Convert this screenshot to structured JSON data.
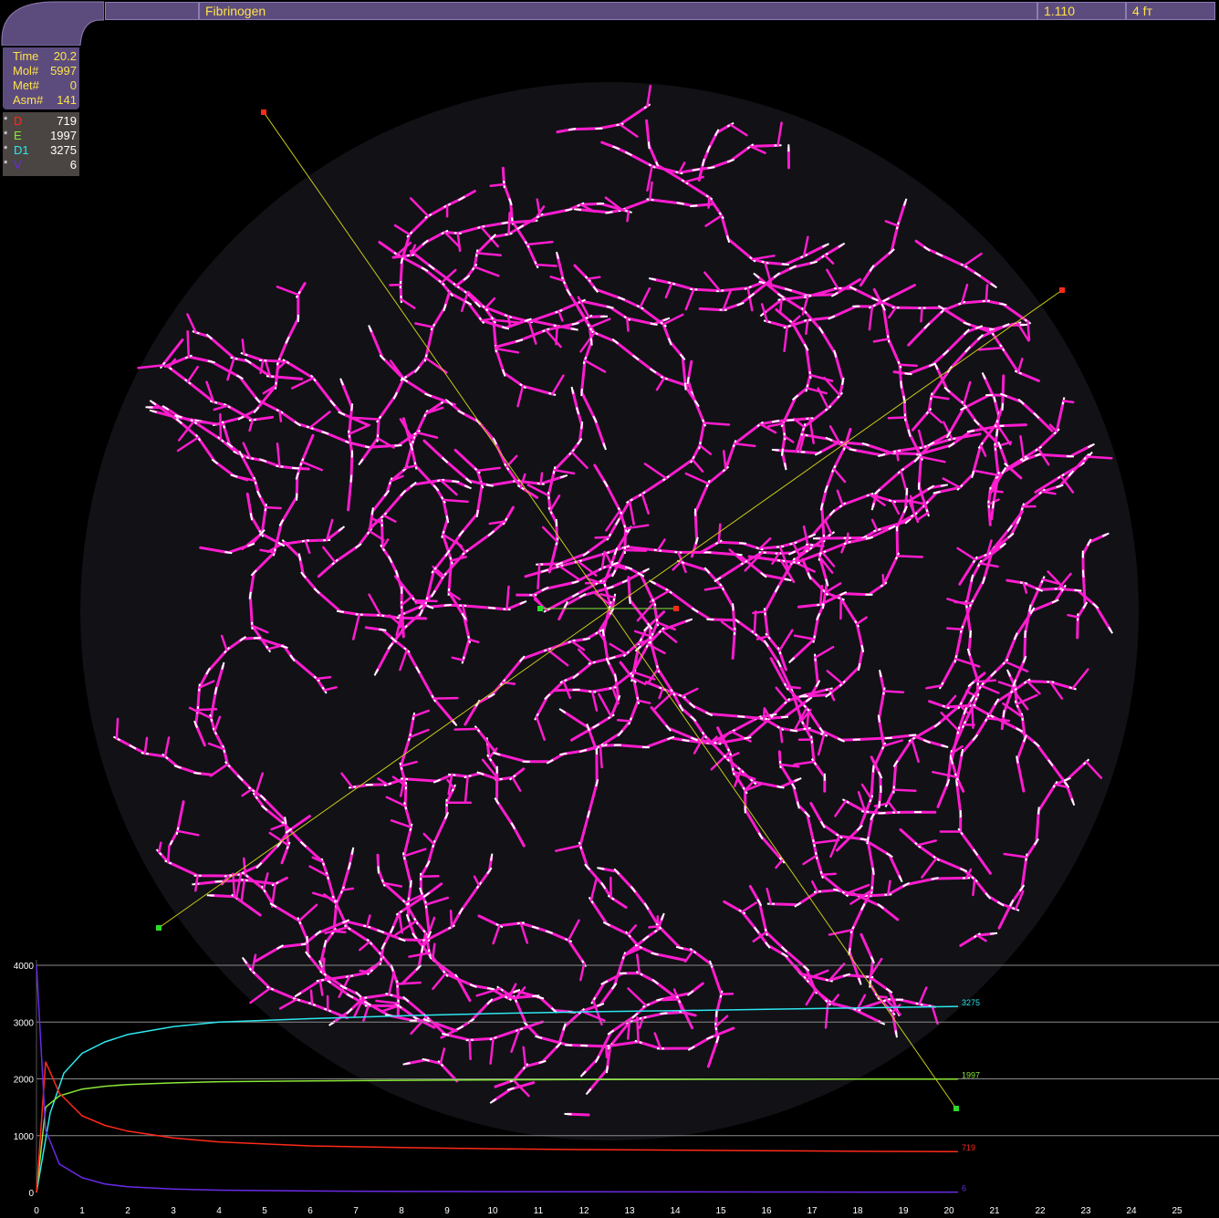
{
  "header": {
    "title": "Fibrinogen",
    "version": "1.110",
    "mode": "4 fт"
  },
  "stats": [
    {
      "label": "Time",
      "value": "20.2"
    },
    {
      "label": "Mol#",
      "value": "5997"
    },
    {
      "label": "Met#",
      "value": "0"
    },
    {
      "label": "Asm#",
      "value": "141"
    }
  ],
  "species": [
    {
      "marker": "*",
      "name": "D",
      "value": "719",
      "color": "#ff2a1a"
    },
    {
      "marker": "*",
      "name": "E",
      "value": "1997",
      "color": "#8be83a"
    },
    {
      "marker": "*",
      "name": "D1",
      "value": "3275",
      "color": "#2ee6ee"
    },
    {
      "marker": "*",
      "name": "V",
      "value": "6",
      "color": "#6a2ae6"
    }
  ],
  "colors": {
    "panel": "#5c4c7e",
    "panel_text": "#ffe34a",
    "disc": "#111116",
    "fiber": "#ff1ccf",
    "guide_line": "#c8c81a"
  },
  "icons": [
    "elbow-connector-shape",
    "handle-square-red",
    "handle-square-green"
  ],
  "chart_data": {
    "type": "line",
    "x_ticks": [
      "0",
      "1",
      "2",
      "3",
      "4",
      "5",
      "6",
      "7",
      "8",
      "9",
      "10",
      "11",
      "12",
      "13",
      "14",
      "15",
      "16",
      "17",
      "18",
      "19",
      "20",
      "21",
      "22",
      "23",
      "24",
      "25"
    ],
    "y_ticks": [
      "0",
      "1000",
      "2000",
      "3000",
      "4000"
    ],
    "xlim": [
      0,
      25
    ],
    "ylim": [
      0,
      4000
    ],
    "grid": "horizontal",
    "series": [
      {
        "name": "D1",
        "end_label": "3275",
        "color": "#2ee6ee",
        "x": [
          0,
          0.3,
          0.6,
          1,
          1.5,
          2,
          3,
          4,
          6,
          8,
          10,
          12,
          14,
          16,
          18,
          20.2
        ],
        "y": [
          0,
          1400,
          2100,
          2450,
          2650,
          2780,
          2920,
          3000,
          3060,
          3110,
          3150,
          3180,
          3200,
          3225,
          3250,
          3275
        ]
      },
      {
        "name": "E",
        "end_label": "1997",
        "color": "#8be83a",
        "x": [
          0,
          0.2,
          0.5,
          1,
          1.5,
          2,
          3,
          4,
          6,
          8,
          10,
          12,
          14,
          16,
          18,
          20.2
        ],
        "y": [
          0,
          1500,
          1700,
          1820,
          1870,
          1900,
          1930,
          1950,
          1965,
          1975,
          1982,
          1987,
          1990,
          1993,
          1995,
          1997
        ]
      },
      {
        "name": "D",
        "end_label": "719",
        "color": "#ff2a1a",
        "x": [
          0,
          0.2,
          0.5,
          1,
          1.5,
          2,
          3,
          4,
          6,
          8,
          10,
          12,
          14,
          16,
          18,
          20.2
        ],
        "y": [
          0,
          2300,
          1750,
          1350,
          1180,
          1080,
          960,
          890,
          820,
          790,
          770,
          755,
          745,
          735,
          725,
          719
        ]
      },
      {
        "name": "V",
        "end_label": "6",
        "color": "#6a2ae6",
        "x": [
          0,
          0.2,
          0.5,
          1,
          1.5,
          2,
          3,
          4,
          6,
          8,
          10,
          12,
          14,
          16,
          18,
          20.2
        ],
        "y": [
          4000,
          1100,
          500,
          260,
          150,
          100,
          60,
          40,
          25,
          18,
          14,
          11,
          9,
          8,
          7,
          6
        ]
      }
    ]
  }
}
